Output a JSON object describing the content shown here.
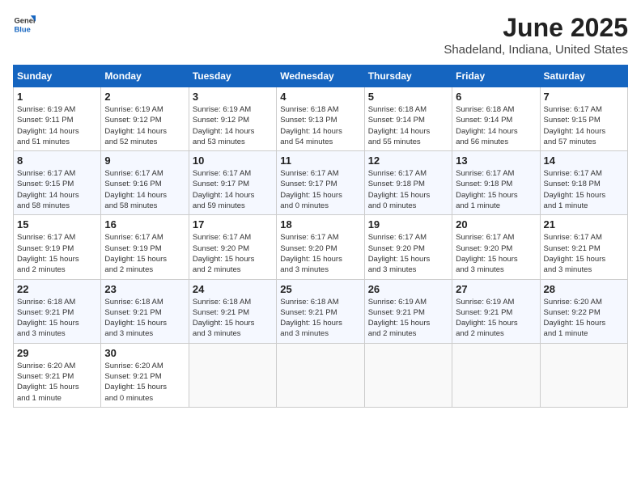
{
  "header": {
    "logo_general": "General",
    "logo_blue": "Blue",
    "title": "June 2025",
    "subtitle": "Shadeland, Indiana, United States"
  },
  "calendar": {
    "days_of_week": [
      "Sunday",
      "Monday",
      "Tuesday",
      "Wednesday",
      "Thursday",
      "Friday",
      "Saturday"
    ],
    "weeks": [
      [
        null,
        {
          "day": "2",
          "sunrise": "6:19 AM",
          "sunset": "9:12 PM",
          "daylight": "14 hours and 52 minutes."
        },
        {
          "day": "3",
          "sunrise": "6:19 AM",
          "sunset": "9:12 PM",
          "daylight": "14 hours and 53 minutes."
        },
        {
          "day": "4",
          "sunrise": "6:18 AM",
          "sunset": "9:13 PM",
          "daylight": "14 hours and 54 minutes."
        },
        {
          "day": "5",
          "sunrise": "6:18 AM",
          "sunset": "9:14 PM",
          "daylight": "14 hours and 55 minutes."
        },
        {
          "day": "6",
          "sunrise": "6:18 AM",
          "sunset": "9:14 PM",
          "daylight": "14 hours and 56 minutes."
        },
        {
          "day": "7",
          "sunrise": "6:17 AM",
          "sunset": "9:15 PM",
          "daylight": "14 hours and 57 minutes."
        }
      ],
      [
        {
          "day": "1",
          "sunrise": "6:19 AM",
          "sunset": "9:11 PM",
          "daylight": "14 hours and 51 minutes."
        },
        {
          "day": "8",
          "sunrise": "6:17 AM",
          "sunset": "9:15 PM",
          "daylight": "14 hours and 58 minutes."
        },
        {
          "day": "9",
          "sunrise": "6:17 AM",
          "sunset": "9:16 PM",
          "daylight": "14 hours and 58 minutes."
        },
        {
          "day": "10",
          "sunrise": "6:17 AM",
          "sunset": "9:17 PM",
          "daylight": "14 hours and 59 minutes."
        },
        {
          "day": "11",
          "sunrise": "6:17 AM",
          "sunset": "9:17 PM",
          "daylight": "15 hours and 0 minutes."
        },
        {
          "day": "12",
          "sunrise": "6:17 AM",
          "sunset": "9:18 PM",
          "daylight": "15 hours and 0 minutes."
        },
        {
          "day": "13",
          "sunrise": "6:17 AM",
          "sunset": "9:18 PM",
          "daylight": "15 hours and 1 minute."
        },
        {
          "day": "14",
          "sunrise": "6:17 AM",
          "sunset": "9:18 PM",
          "daylight": "15 hours and 1 minute."
        }
      ],
      [
        {
          "day": "15",
          "sunrise": "6:17 AM",
          "sunset": "9:19 PM",
          "daylight": "15 hours and 2 minutes."
        },
        {
          "day": "16",
          "sunrise": "6:17 AM",
          "sunset": "9:19 PM",
          "daylight": "15 hours and 2 minutes."
        },
        {
          "day": "17",
          "sunrise": "6:17 AM",
          "sunset": "9:20 PM",
          "daylight": "15 hours and 2 minutes."
        },
        {
          "day": "18",
          "sunrise": "6:17 AM",
          "sunset": "9:20 PM",
          "daylight": "15 hours and 3 minutes."
        },
        {
          "day": "19",
          "sunrise": "6:17 AM",
          "sunset": "9:20 PM",
          "daylight": "15 hours and 3 minutes."
        },
        {
          "day": "20",
          "sunrise": "6:17 AM",
          "sunset": "9:20 PM",
          "daylight": "15 hours and 3 minutes."
        },
        {
          "day": "21",
          "sunrise": "6:17 AM",
          "sunset": "9:21 PM",
          "daylight": "15 hours and 3 minutes."
        }
      ],
      [
        {
          "day": "22",
          "sunrise": "6:18 AM",
          "sunset": "9:21 PM",
          "daylight": "15 hours and 3 minutes."
        },
        {
          "day": "23",
          "sunrise": "6:18 AM",
          "sunset": "9:21 PM",
          "daylight": "15 hours and 3 minutes."
        },
        {
          "day": "24",
          "sunrise": "6:18 AM",
          "sunset": "9:21 PM",
          "daylight": "15 hours and 3 minutes."
        },
        {
          "day": "25",
          "sunrise": "6:18 AM",
          "sunset": "9:21 PM",
          "daylight": "15 hours and 3 minutes."
        },
        {
          "day": "26",
          "sunrise": "6:19 AM",
          "sunset": "9:21 PM",
          "daylight": "15 hours and 2 minutes."
        },
        {
          "day": "27",
          "sunrise": "6:19 AM",
          "sunset": "9:21 PM",
          "daylight": "15 hours and 2 minutes."
        },
        {
          "day": "28",
          "sunrise": "6:20 AM",
          "sunset": "9:22 PM",
          "daylight": "15 hours and 1 minute."
        }
      ],
      [
        {
          "day": "29",
          "sunrise": "6:20 AM",
          "sunset": "9:21 PM",
          "daylight": "15 hours and 1 minute."
        },
        {
          "day": "30",
          "sunrise": "6:20 AM",
          "sunset": "9:21 PM",
          "daylight": "15 hours and 0 minutes."
        },
        null,
        null,
        null,
        null,
        null
      ]
    ]
  }
}
